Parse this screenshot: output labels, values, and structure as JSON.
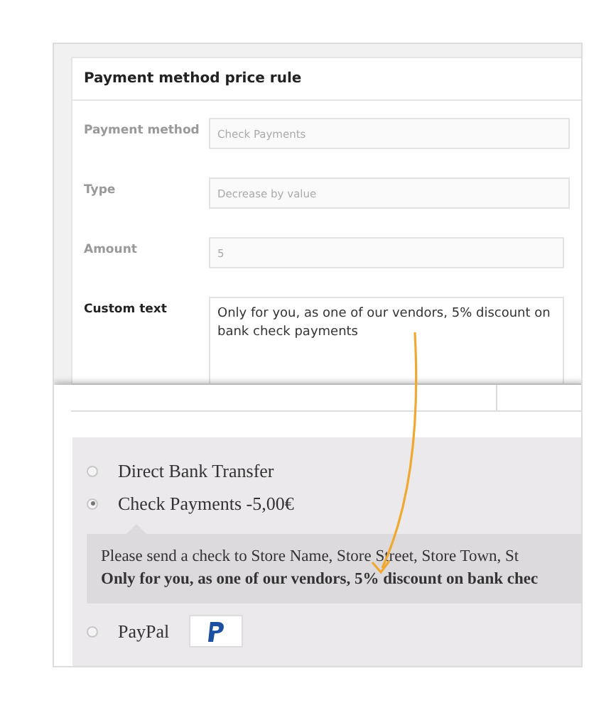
{
  "rule_panel": {
    "title": "Payment method price rule",
    "fields": [
      {
        "label": "Payment method",
        "value": "Check Payments",
        "disabled": true,
        "kind": "select"
      },
      {
        "label": "Type",
        "value": "Decrease by value",
        "disabled": true,
        "kind": "select"
      },
      {
        "label": "Amount",
        "value": "5",
        "disabled": true,
        "kind": "input"
      },
      {
        "label": "Custom text",
        "value": "Only for you, as one of our vendors, 5% discount on bank check payments",
        "disabled": false,
        "kind": "textarea"
      }
    ]
  },
  "checkout": {
    "methods": [
      {
        "label": "Direct Bank Transfer",
        "selected": false
      },
      {
        "label": "Check Payments -5,00€",
        "selected": true,
        "description": {
          "text": "Please send a check to Store Name, Store Street, Store Town, St",
          "note": "Only for you, as one of our vendors, 5% discount on bank chec"
        }
      },
      {
        "label": "PayPal",
        "selected": false,
        "logo": true
      }
    ]
  }
}
